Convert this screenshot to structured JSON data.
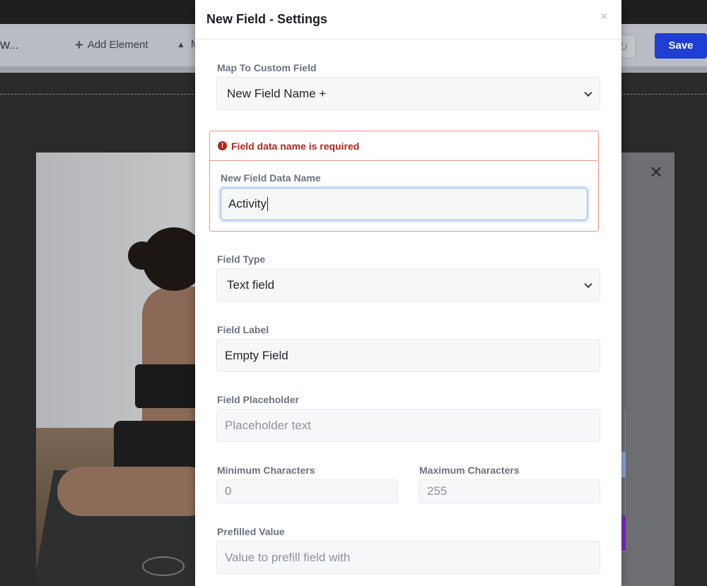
{
  "toolbar": {
    "crumb": "W...",
    "add_element": "Add Element",
    "more_label": "M",
    "save": "Save"
  },
  "modal": {
    "title": "New Field - Settings",
    "close_glyph": "×",
    "map_custom_field": {
      "label": "Map To Custom Field",
      "value": "New Field Name +"
    },
    "error": {
      "message": "Field data name is required",
      "icon": "exclamation-icon"
    },
    "data_name": {
      "label": "New Field Data Name",
      "value": "Activity"
    },
    "field_type": {
      "label": "Field Type",
      "value": "Text field"
    },
    "field_label": {
      "label": "Field Label",
      "value": "Empty Field"
    },
    "field_placeholder": {
      "label": "Field Placeholder",
      "placeholder": "Placeholder text"
    },
    "min_chars": {
      "label": "Minimum Characters",
      "placeholder": "0"
    },
    "max_chars": {
      "label": "Maximum Characters",
      "placeholder": "255"
    },
    "prefilled": {
      "label": "Prefilled Value",
      "placeholder": "Value to prefill field with"
    }
  },
  "colors": {
    "save_button": "#1f3fd4",
    "error": "#b3261e",
    "error_border": "#f0928a",
    "focus_border": "#8fb4e8"
  }
}
